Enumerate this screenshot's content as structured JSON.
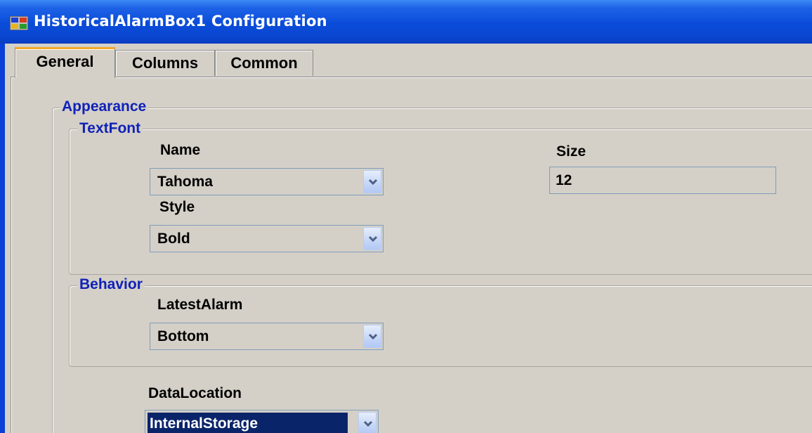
{
  "window": {
    "title": "HistoricalAlarmBox1 Configuration",
    "icon": "app-window-icon"
  },
  "tabs": [
    {
      "label": "General",
      "active": true
    },
    {
      "label": "Columns",
      "active": false
    },
    {
      "label": "Common",
      "active": false
    }
  ],
  "appearance": {
    "group_label": "Appearance",
    "textfont": {
      "group_label": "TextFont",
      "name_label": "Name",
      "name_value": "Tahoma",
      "size_label": "Size",
      "size_value": "12",
      "style_label": "Style",
      "style_value": "Bold"
    },
    "behavior": {
      "group_label": "Behavior",
      "latest_alarm_label": "LatestAlarm",
      "latest_alarm_value": "Bottom"
    },
    "data_location_label": "DataLocation",
    "data_location_value": "InternalStorage"
  },
  "colors": {
    "title_bar": "#0a46d0",
    "group_label": "#1021b8",
    "active_tab_accent": "#f4a824",
    "selection": "#0a246a",
    "dialog_bg": "#d4d0c8"
  }
}
